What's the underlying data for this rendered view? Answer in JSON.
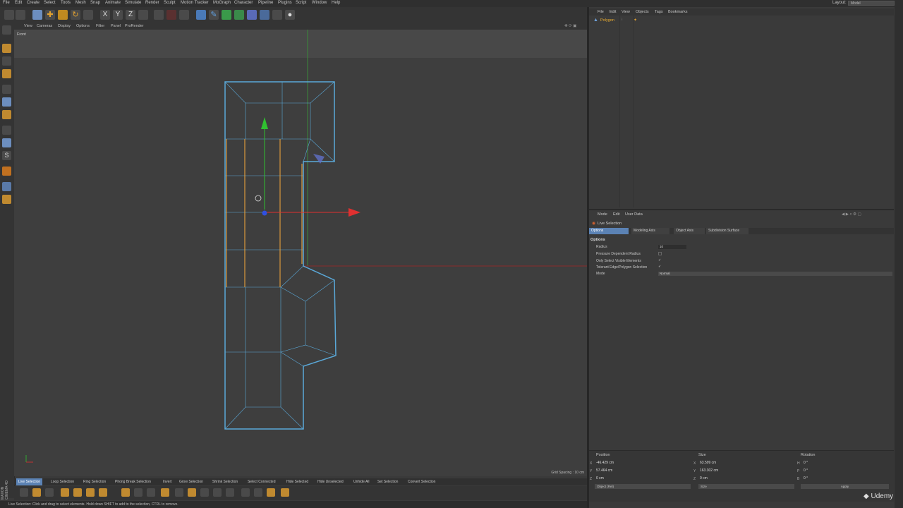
{
  "menubar": {
    "items": [
      "File",
      "Edit",
      "Create",
      "Select",
      "Tools",
      "Mesh",
      "Snap",
      "Animate",
      "Simulate",
      "Render",
      "Sculpt",
      "Motion Tracker",
      "MoGraph",
      "Character",
      "Pipeline",
      "Plugins",
      "Script",
      "Window",
      "Help"
    ],
    "layout_label": "Layout:",
    "layout_value": "Model"
  },
  "viewport": {
    "menu": [
      "View",
      "Cameras",
      "Display",
      "Options",
      "Filter",
      "Panel",
      "ProRender"
    ],
    "label": "Front",
    "grid_spacing": "Grid Spacing : 10 cm"
  },
  "bottom_tools": [
    "Live Selection",
    "Loop Selection",
    "Ring Selection",
    "Phong Break Selection",
    "Invert",
    "Grow Selection",
    "Shrink Selection",
    "Select Connected",
    "Hide Selected",
    "Hide Unselected",
    "Unhide All",
    "Set Selection",
    "Convert Selection"
  ],
  "status": {
    "text": "Live Selection: Click and drag to select elements. Hold down SHIFT to add to the selection, CTRL to remove."
  },
  "object_manager": {
    "menu": [
      "File",
      "Edit",
      "View",
      "Objects",
      "Tags",
      "Bookmarks"
    ],
    "object_name": "Polygon"
  },
  "attributes": {
    "menu": [
      "Mode",
      "Edit",
      "User Data"
    ],
    "title": "Live Selection",
    "tabs": [
      "Options",
      "Modeling Axis",
      "Object Axis",
      "Subdivision Surface"
    ],
    "section": "Options",
    "radius_label": "Radius",
    "radius_value": "10",
    "pressure_label": "Pressure Dependent Radius",
    "pressure_value": "",
    "visible_label": "Only Select Visible Elements",
    "visible_value": "✓",
    "tolerant_label": "Tolerant Edge/Polygon Selection",
    "tolerant_value": "✓",
    "mode_label": "Mode",
    "mode_value": "Normal"
  },
  "coordinates": {
    "position_header": "Position",
    "size_header": "Size",
    "rotation_header": "Rotation",
    "pos_x": "-46.429 cm",
    "pos_y": "57.464 cm",
    "pos_z": "0 cm",
    "size_x": "63.599 cm",
    "size_y": "163.302 cm",
    "size_z": "0 cm",
    "rot_h": "0 °",
    "rot_p": "0 °",
    "rot_b": "0 °",
    "axis_x": "X",
    "axis_y": "Y",
    "axis_z": "Z",
    "axis_h": "H",
    "axis_p": "P",
    "axis_b": "B",
    "object_mode": "Object (Rel)",
    "size_mode": "Size",
    "apply_label": "Apply"
  },
  "watermark": "Udemy",
  "logo": "MAXON CINEMA 4D",
  "colors": {
    "accent": "#5b82b4",
    "selection_edge": "#e8a03c",
    "wireframe": "#5aa8d8",
    "axis_x": "#e03030",
    "axis_y": "#30c030",
    "axis_z": "#3050e0"
  }
}
